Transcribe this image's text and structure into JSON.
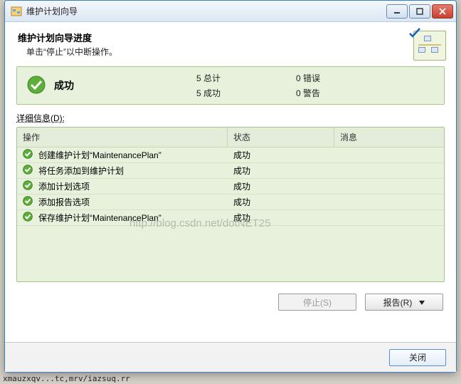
{
  "titlebar": {
    "title": "维护计划向导"
  },
  "header": {
    "title": "维护计划向导进度",
    "subtitle": "单击“停止”以中断操作。"
  },
  "status": {
    "label": "成功",
    "total_count": "5",
    "total_label": "总计",
    "success_count": "5",
    "success_label": "成功",
    "error_count": "0",
    "error_label": "错误",
    "warn_count": "0",
    "warn_label": "警告"
  },
  "details_label": "详细信息(D):",
  "table": {
    "headers": {
      "action": "操作",
      "status": "状态",
      "message": "消息"
    },
    "rows": [
      {
        "action": "创建维护计划“MaintenancePlan”",
        "status": "成功",
        "message": ""
      },
      {
        "action": "将任务添加到维护计划",
        "status": "成功",
        "message": ""
      },
      {
        "action": "添加计划选项",
        "status": "成功",
        "message": ""
      },
      {
        "action": "添加报告选项",
        "status": "成功",
        "message": ""
      },
      {
        "action": "保存维护计划“MaintenancePlan”",
        "status": "成功",
        "message": ""
      }
    ]
  },
  "buttons": {
    "stop": "停止(S)",
    "report": "报告(R)",
    "close": "关闭"
  },
  "watermark": "http://blog.csdn.net/dotNET25",
  "garble": "xmauzxqv...tc,mrv/iazsuq.rr"
}
